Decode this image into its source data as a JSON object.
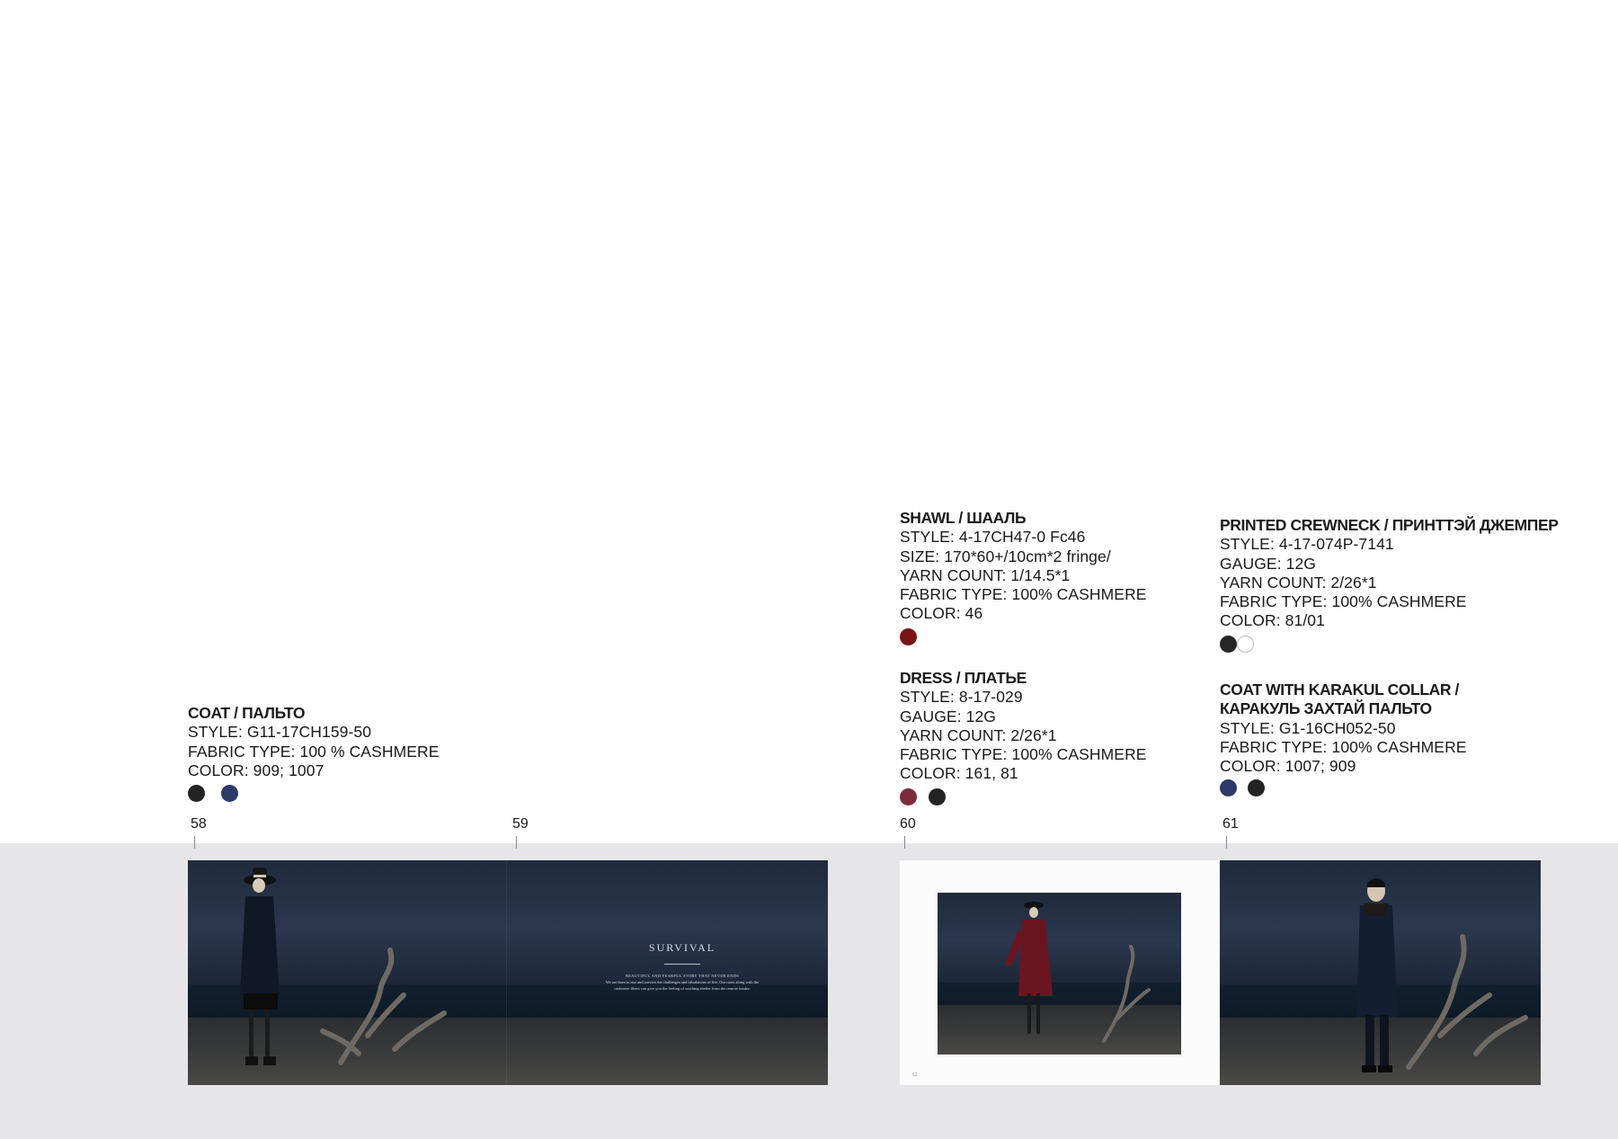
{
  "products": {
    "coat": {
      "title": "COAT / ПАЛЬТО",
      "lines": [
        "STYLE: G11-17CH159-50",
        "FABRIC TYPE: 100 % CASHMERE",
        "COLOR: 909; 1007"
      ],
      "swatches": [
        "#232323",
        "#2b3a66"
      ]
    },
    "shawl": {
      "title": "SHAWL / ШААЛЬ",
      "lines": [
        "STYLE: 4-17CH47-0 Fc46",
        "SIZE: 170*60+/10cm*2 fringe/",
        "YARN COUNT: 1/14.5*1",
        "FABRIC TYPE: 100% CASHMERE",
        "COLOR: 46"
      ],
      "swatches": [
        "#7a1515"
      ]
    },
    "dress": {
      "title": "DRESS / ПЛАТЬЕ",
      "lines": [
        "STYLE:  8-17-029",
        "GAUGE: 12G",
        "YARN COUNT: 2/26*1",
        "FABRIC TYPE: 100% CASHMERE",
        "COLOR: 161, 81"
      ],
      "swatches": [
        "#7d2a3c",
        "#232323"
      ]
    },
    "crewneck": {
      "title": "PRINTED CREWNECK / ПРИНТТЭЙ ДЖЕМПЕР",
      "lines": [
        "STYLE: 4-17-074P-7141",
        "GAUGE: 12G",
        "YARN COUNT: 2/26*1",
        "FABRIC TYPE: 100% CASHMERE",
        "COLOR: 81/01"
      ],
      "swatches": [
        "#262626",
        "#ffffff"
      ]
    },
    "karakul": {
      "title_line1": "COAT WITH KARAKUL COLLAR  /",
      "title_line2": "КАРАКУЛЬ ЗАХТАЙ ПАЛЬТО",
      "lines": [
        "STYLE: G1-16CH052-50",
        "FABRIC TYPE: 100% CASHMERE",
        "COLOR: 1007; 909"
      ],
      "swatches": [
        "#2b3a66",
        "#232323"
      ]
    }
  },
  "pages": [
    "58",
    "59",
    "60",
    "61"
  ],
  "spread": {
    "headline": "SURVIVAL",
    "tagline": "BEAUTIFUL AND FEARFUL STORY THAT NEVER ENDS",
    "body": "We are born to rise and survive the challenges and tribulations of life. Our roots along with the cashmere fibers can give you the feeling of soothing shelter from the remote tundra."
  },
  "page60_folio": "62"
}
